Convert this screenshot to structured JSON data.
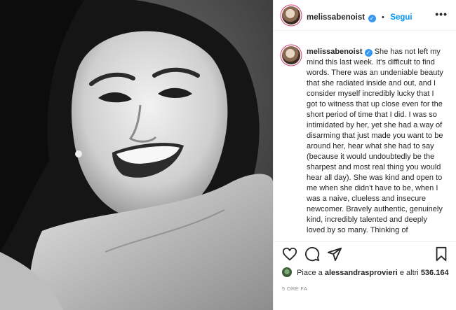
{
  "post": {
    "username": "melissabenoist",
    "verified_glyph": "✓",
    "separator": "•",
    "follow_label": "Segui",
    "more_glyph": "•••",
    "caption": "She has not left my mind this last week. It's difficult to find words. There was an undeniable beauty that she radiated inside and out, and I consider myself incredibly lucky that I got to witness that up close even for the short period of time that I did. I was so intimidated by her, yet she had a way of disarming that just made you want to be around her, hear what she had to say (because it would undoubtedly be the sharpest and most real thing you would hear all day). She was kind and open to me when she didn't have to be, when I was a naive, clueless and insecure newcomer. Bravely authentic, genuinely kind, incredibly talented and deeply loved by so many. Thinking of",
    "likes": {
      "prefix": "Piace a",
      "user": "alessandrasprovieri",
      "connector": "e altri",
      "count": "536.164"
    },
    "timestamp": "5 ORE FA"
  },
  "icons": [
    "heart-icon",
    "comment-icon",
    "share-icon",
    "bookmark-icon",
    "more-options-icon",
    "verified-badge-icon"
  ],
  "colors": {
    "accent": "#0095f6",
    "verified": "#3897f0",
    "text": "#262626",
    "muted": "#8e8e8e",
    "story_ring": "#d63c6c"
  }
}
